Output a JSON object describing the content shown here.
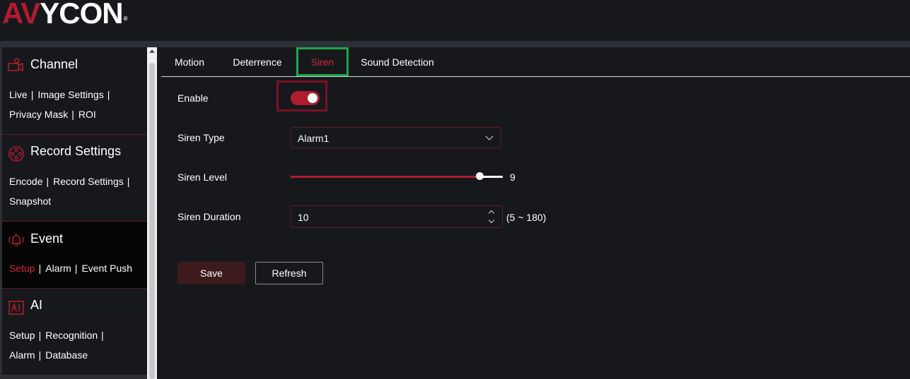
{
  "brand": {
    "logo_accent": "AV",
    "logo_rest": "YCON",
    "registered": "®"
  },
  "colors": {
    "accent": "#b01c2e",
    "active_link": "#d0263a",
    "tab_highlight": "#1ea54a",
    "background": "#17181c"
  },
  "sidebar": {
    "sections": [
      {
        "title": "Channel",
        "icon": "camera-icon",
        "links": [
          "Live",
          "Image Settings",
          "Privacy Mask",
          "ROI"
        ]
      },
      {
        "title": "Record Settings",
        "icon": "film-reel-icon",
        "links": [
          "Encode",
          "Record Settings",
          "Snapshot"
        ]
      },
      {
        "title": "Event",
        "icon": "alarm-bell-icon",
        "links": [
          "Setup",
          "Alarm",
          "Event Push"
        ],
        "active_link": "Setup"
      },
      {
        "title": "AI",
        "icon": "ai-icon",
        "links": [
          "Setup",
          "Recognition",
          "Alarm",
          "Database"
        ]
      }
    ]
  },
  "tabs": [
    {
      "label": "Motion"
    },
    {
      "label": "Deterrence"
    },
    {
      "label": "Siren",
      "active": true
    },
    {
      "label": "Sound Detection"
    }
  ],
  "form": {
    "enable_label": "Enable",
    "enable_on": true,
    "siren_type_label": "Siren Type",
    "siren_type_value": "Alarm1",
    "siren_level_label": "Siren Level",
    "siren_level_value": "9",
    "siren_level_fraction": 0.89,
    "siren_duration_label": "Siren Duration",
    "siren_duration_value": "10",
    "siren_duration_range": "(5 ~ 180)"
  },
  "buttons": {
    "save": "Save",
    "refresh": "Refresh"
  }
}
